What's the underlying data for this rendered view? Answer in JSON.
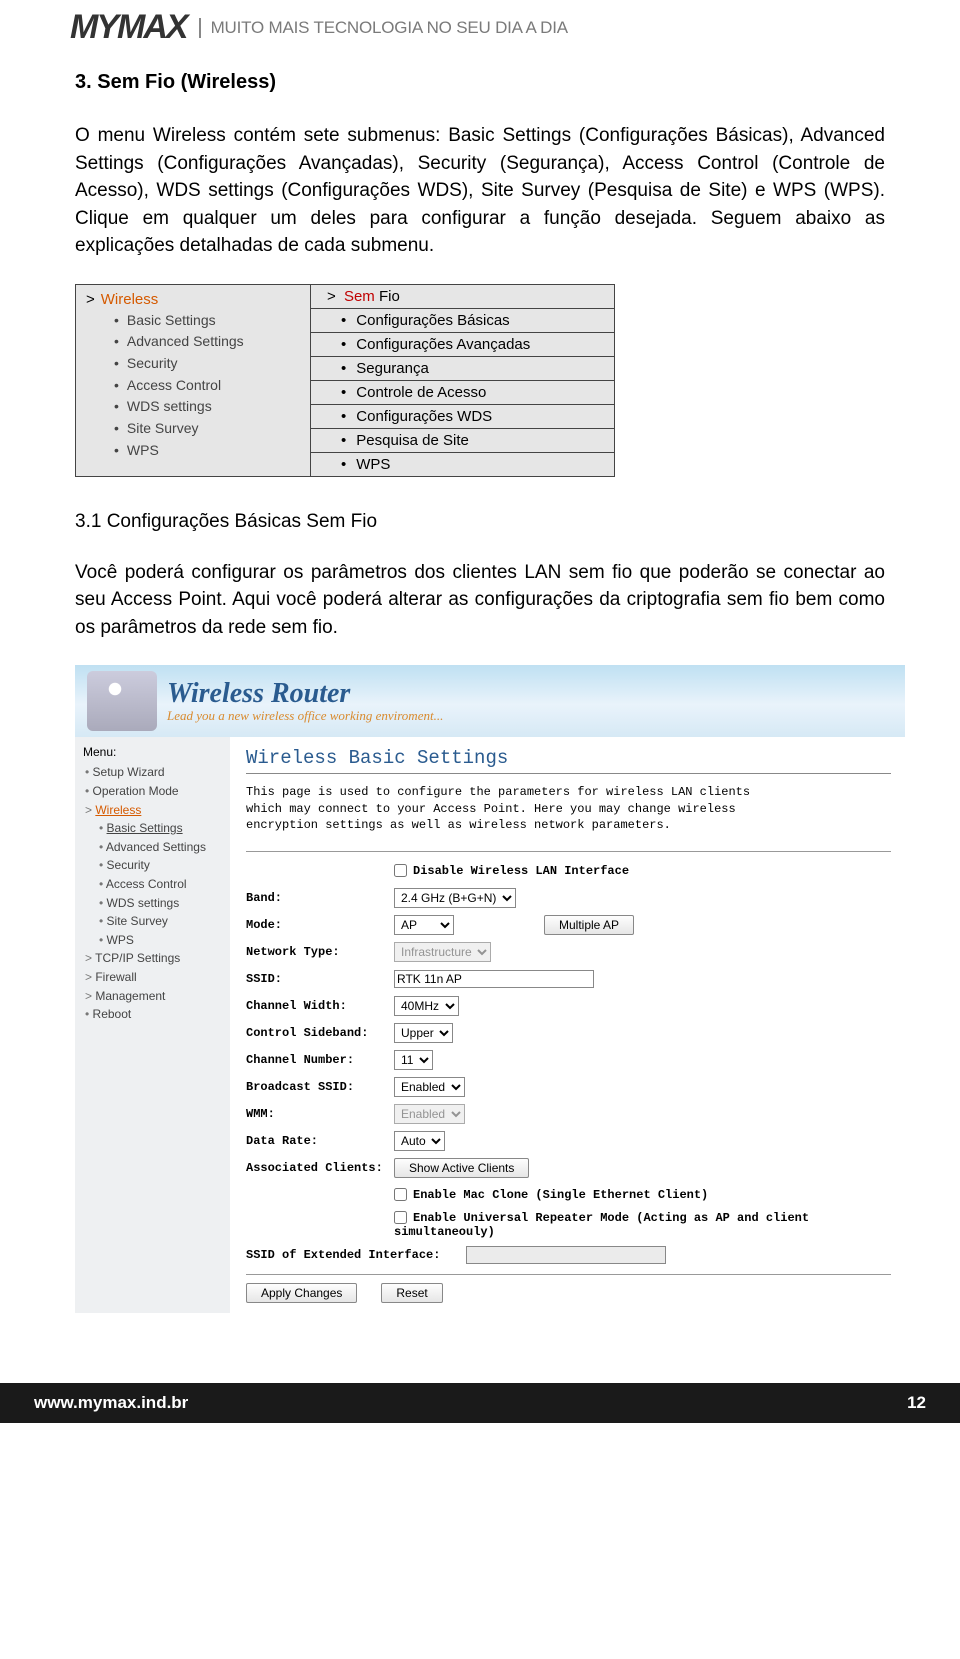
{
  "header": {
    "logo": "MYMAX",
    "tagline": "MUITO MAIS TECNOLOGIA NO SEU DIA A DIA"
  },
  "section": {
    "title": "3. Sem Fio (Wireless)",
    "intro": "O menu Wireless contém sete submenus: Basic Settings (Configurações Básicas), Advanced Settings (Configurações Avançadas), Security (Segurança), Access Control (Controle de Acesso), WDS settings (Configurações WDS), Site Survey (Pesquisa de Site) e WPS (WPS). Clique em qualquer um deles para configurar a função desejada. Seguem abaixo as explicações detalhadas de cada submenu."
  },
  "menu_compare": {
    "left_top": "Wireless",
    "left_items": [
      "Basic Settings",
      "Advanced Settings",
      "Security",
      "Access Control",
      "WDS settings",
      "Site Survey",
      "WPS"
    ],
    "right_header_prefix": "> ",
    "right_header_sem": "Sem",
    "right_header_fio": " Fio",
    "right_items": [
      "Configurações Básicas",
      "Configurações Avançadas",
      "Segurança",
      "Controle de Acesso",
      "Configurações WDS",
      "Pesquisa de Site",
      "WPS"
    ]
  },
  "subsection": {
    "title": "3.1 Configurações Básicas Sem Fio",
    "intro": "Você poderá configurar os parâmetros dos clientes LAN sem fio que poderão se conectar ao seu Access Point. Aqui você poderá alterar as configurações da criptografia sem fio bem como os parâmetros da rede sem fio."
  },
  "banner": {
    "title": "Wireless Router",
    "subtitle": "Lead you a new wireless office working enviroment..."
  },
  "left_menu": {
    "title": "Menu:",
    "items": [
      {
        "label": "Setup Wizard",
        "cls": ""
      },
      {
        "label": "Operation Mode",
        "cls": ""
      },
      {
        "label": "Wireless",
        "cls": "gt sel"
      },
      {
        "label": "Basic Settings",
        "cls": "sub u"
      },
      {
        "label": "Advanced Settings",
        "cls": "sub"
      },
      {
        "label": "Security",
        "cls": "sub"
      },
      {
        "label": "Access Control",
        "cls": "sub"
      },
      {
        "label": "WDS settings",
        "cls": "sub"
      },
      {
        "label": "Site Survey",
        "cls": "sub"
      },
      {
        "label": "WPS",
        "cls": "sub"
      },
      {
        "label": "TCP/IP Settings",
        "cls": "gt"
      },
      {
        "label": "Firewall",
        "cls": "gt"
      },
      {
        "label": "Management",
        "cls": "gt"
      },
      {
        "label": "Reboot",
        "cls": ""
      }
    ]
  },
  "settings": {
    "page_title": "Wireless Basic Settings",
    "intro": "This page is used to configure the parameters for wireless LAN clients which may connect to your Access Point. Here you may change wireless encryption settings as well as wireless network parameters.",
    "disable_label": "Disable Wireless LAN Interface",
    "rows": {
      "band": {
        "label": "Band:",
        "value": "2.4 GHz (B+G+N)"
      },
      "mode": {
        "label": "Mode:",
        "value": "AP",
        "button": "Multiple AP"
      },
      "network_type": {
        "label": "Network Type:",
        "value": "Infrastructure"
      },
      "ssid": {
        "label": "SSID:",
        "value": "RTK 11n AP"
      },
      "chwidth": {
        "label": "Channel Width:",
        "value": "40MHz"
      },
      "sideband": {
        "label": "Control Sideband:",
        "value": "Upper"
      },
      "channel": {
        "label": "Channel Number:",
        "value": "11"
      },
      "bcast": {
        "label": "Broadcast SSID:",
        "value": "Enabled"
      },
      "wmm": {
        "label": "WMM:",
        "value": "Enabled"
      },
      "datarate": {
        "label": "Data Rate:",
        "value": "Auto"
      },
      "assoc": {
        "label": "Associated Clients:",
        "button": "Show Active Clients"
      },
      "macclone": "Enable Mac Clone (Single Ethernet Client)",
      "urepeater": "Enable Universal Repeater Mode (Acting as AP and client simultaneouly)",
      "ssid_ext": {
        "label": "SSID of Extended Interface:",
        "value": ""
      }
    },
    "buttons": {
      "apply": "Apply Changes",
      "reset": "Reset"
    }
  },
  "footer": {
    "url": "www.mymax.ind.br",
    "page": "12"
  }
}
